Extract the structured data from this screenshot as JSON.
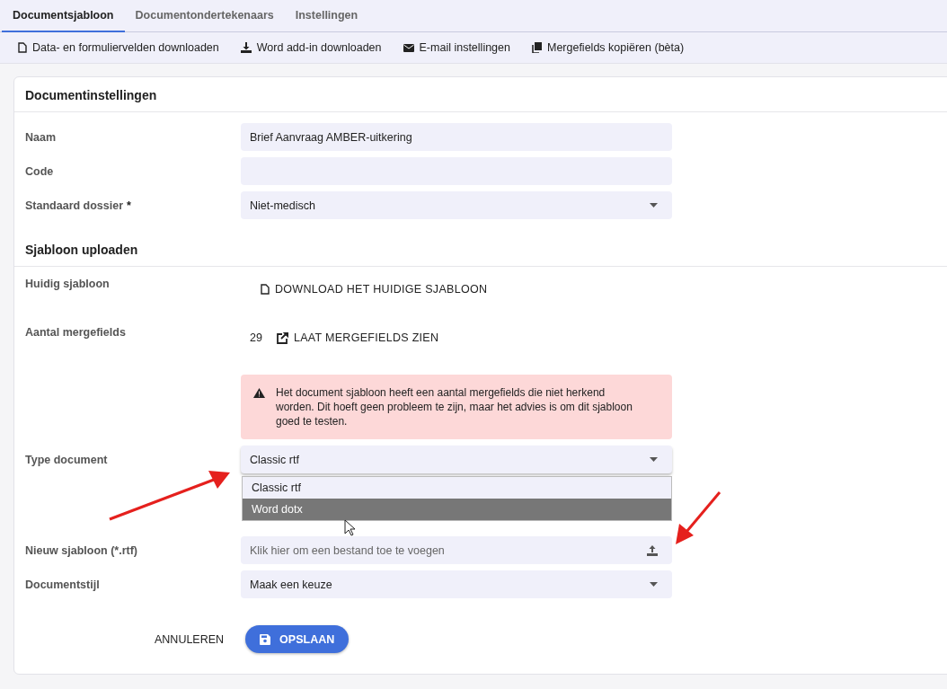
{
  "tabs": [
    {
      "label": "Documentsjabloon",
      "selected": true
    },
    {
      "label": "Documentondertekenaars",
      "selected": false
    },
    {
      "label": "Instellingen",
      "selected": false
    }
  ],
  "toolbar": [
    {
      "label": "Data- en formuliervelden downloaden"
    },
    {
      "label": "Word add-in downloaden"
    },
    {
      "label": "E-mail instellingen"
    },
    {
      "label": "Mergefields kopiëren (bèta)"
    }
  ],
  "sections": [
    {
      "title": "Documentinstellingen",
      "fields": [
        {
          "kind": "text",
          "label": "Naam",
          "value": "Brief Aanvraag AMBER-uitkering"
        },
        {
          "kind": "text",
          "label": "Code"
        },
        {
          "kind": "select",
          "label": "Standaard dossier",
          "required_mark": "*",
          "value": "Niet-medisch"
        }
      ]
    },
    {
      "title": "Sjabloon uploaden",
      "fields": [
        {
          "kind": "link",
          "label": "Huidig sjabloon",
          "link": "DOWNLOAD HET HUIDIGE SJABLOON"
        },
        {
          "kind": "count",
          "label": "Aantal mergefields",
          "count": "29",
          "link": "LAAT MERGEFIELDS ZIEN"
        },
        {
          "kind": "alert",
          "text": "Het document sjabloon heeft een aantal mergefields die niet herkend worden. Dit hoeft geen probleem te zijn, maar het advies is om dit sjabloon goed te testen."
        },
        {
          "kind": "select",
          "label": "Type document",
          "value": "Classic rtf",
          "open": true,
          "options": [
            {
              "label": "Classic rtf",
              "highlighted": false
            },
            {
              "label": "Word dotx",
              "highlighted": true
            }
          ]
        },
        {
          "kind": "file",
          "label": "Nieuw sjabloon (*.rtf)",
          "placeholder": "Klik hier om een bestand toe te voegen"
        },
        {
          "kind": "select",
          "label": "Documentstijl",
          "value": "Maak een keuze"
        }
      ]
    }
  ],
  "actions": {
    "cancel": "ANNULEREN",
    "save": "OPSLAAN"
  }
}
